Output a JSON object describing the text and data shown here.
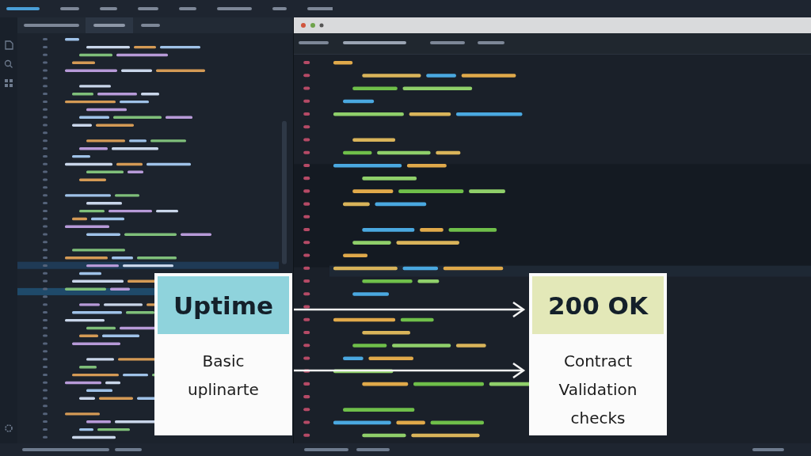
{
  "cards": [
    {
      "title": "Uptime",
      "color": "#8fd3dc",
      "body": "Basic uplinarte"
    },
    {
      "title": "200 OK",
      "color": "#e3e8b8",
      "body": "Contract Validation checks"
    }
  ]
}
